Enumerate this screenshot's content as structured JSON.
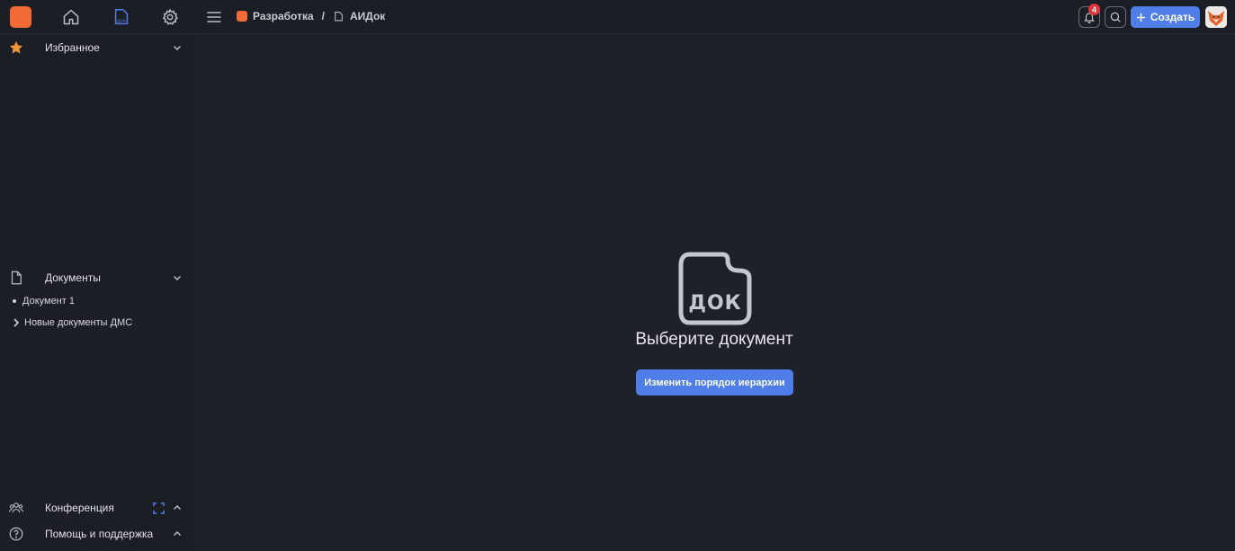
{
  "topbar": {
    "icons": [
      "home-icon",
      "document-icon",
      "gear-icon"
    ],
    "breadcrumb": [
      {
        "label": "Разработка"
      },
      {
        "label": "АИДок"
      }
    ],
    "notifications_count": "4",
    "create_label": "Создать"
  },
  "sidebar": {
    "favorites_label": "Избранное",
    "documents_label": "Документы",
    "documents": [
      {
        "label": "Документ 1",
        "type": "bullet"
      },
      {
        "label": "Новые документы ДМС",
        "type": "folder"
      }
    ],
    "conference_label": "Конференция",
    "help_label": "Помощь и поддержка"
  },
  "main": {
    "empty_icon_text": "ДОК",
    "empty_title": "Выберите документ",
    "reorder_button": "Изменить порядок иерархии"
  },
  "colors": {
    "accent": "#4f7ee8",
    "brand": "#f26a35",
    "badge": "#e0343b",
    "background": "#1e2029"
  }
}
